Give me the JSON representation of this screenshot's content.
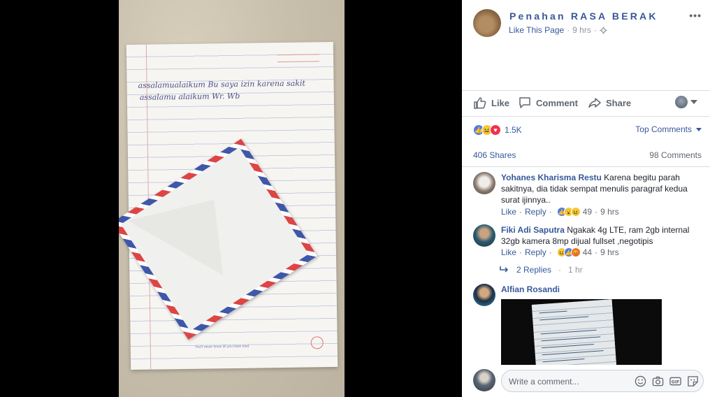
{
  "photo": {
    "handwriting": [
      "assalamualaikum  Bu  saya  izin  karena  sakit",
      "assalamu  alaikum  Wr. Wb"
    ],
    "paper_footer": "You'll never know till you have tried"
  },
  "post": {
    "page_name": "Penahan RASA BERAK",
    "like_page": "Like This Page",
    "time": "9 hrs",
    "more": "•••"
  },
  "actions": {
    "like": "Like",
    "comment": "Comment",
    "share": "Share"
  },
  "stats": {
    "reaction_count": "1.5K",
    "top_comments": "Top Comments",
    "shares": "406 Shares",
    "comments": "98 Comments"
  },
  "comments": [
    {
      "name": "Yohanes Kharisma Restu",
      "text": " Karena begitu parah sakitnya, dia tidak sempat menulis paragraf kedua surat ijinnya..",
      "like": "Like",
      "reply": "Reply",
      "reactions": "49",
      "time": "9 hrs"
    },
    {
      "name": "Fiki Adi Saputra",
      "text": " Ngakak 4g LTE, ram 2gb internal 32gb kamera 8mp dijual fullset ,negotipis",
      "like": "Like",
      "reply": "Reply",
      "reactions": "44",
      "time": "9 hrs"
    },
    {
      "name": "Alfian Rosandi",
      "text": ""
    }
  ],
  "replies": {
    "label": "2 Replies",
    "time": "1 hr"
  },
  "composer": {
    "placeholder": "Write a comment..."
  },
  "colors": {
    "link": "#365899",
    "muted": "#606770",
    "reaction_like": "#4a7bf0",
    "reaction_love": "#f0324f",
    "reaction_haha": "#f7c93c"
  }
}
